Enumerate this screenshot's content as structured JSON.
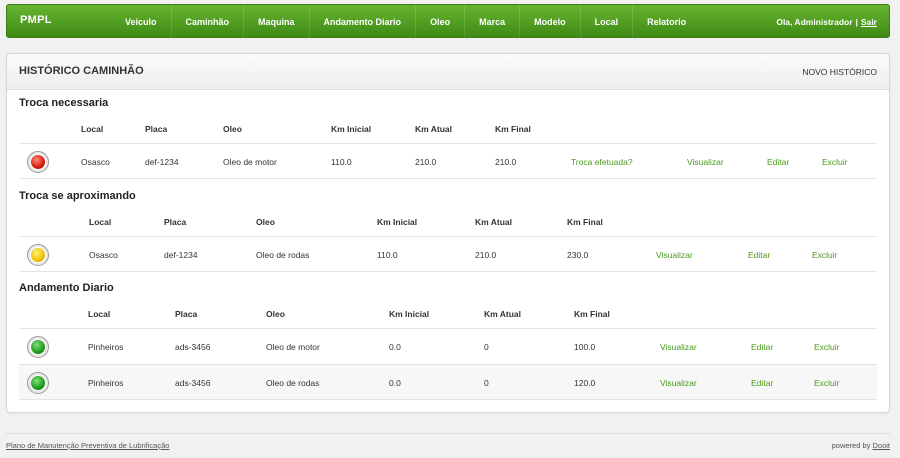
{
  "nav": {
    "brand": "PMPL",
    "items": [
      "Veiculo",
      "Caminhão",
      "Maquina",
      "Andamento Diario",
      "Oleo",
      "Marca",
      "Modelo",
      "Local",
      "Relatorio"
    ],
    "greeting": "Ola, Administrador",
    "separator": "|",
    "logout": "Sair"
  },
  "panel": {
    "title": "HISTÓRICO CAMINHÃO",
    "action": "NOVO HISTÓRICO"
  },
  "sections": [
    {
      "title": "Troca necessaria",
      "headers": [
        "Local",
        "Placa",
        "Oleo",
        "Km Inicial",
        "Km Atual",
        "Km Final"
      ],
      "rows": [
        {
          "status": "red",
          "local": "Osasco",
          "placa": "def-1234",
          "oleo": "Oleo de motor",
          "km_inicial": "110.0",
          "km_atual": "210.0",
          "km_final": "210.0",
          "troca": "Troca efetuada?",
          "visualizar": "Visualizar",
          "editar": "Editar",
          "excluir": "Excluir"
        }
      ]
    },
    {
      "title": "Troca se aproximando",
      "headers": [
        "Local",
        "Placa",
        "Oleo",
        "Km Inicial",
        "Km Atual",
        "Km Final"
      ],
      "rows": [
        {
          "status": "yellow",
          "local": "Osasco",
          "placa": "def-1234",
          "oleo": "Oleo de rodas",
          "km_inicial": "110.0",
          "km_atual": "210.0",
          "km_final": "230.0",
          "visualizar": "Visualizar",
          "editar": "Editar",
          "excluir": "Excluir"
        }
      ]
    },
    {
      "title": "Andamento Diario",
      "headers": [
        "Local",
        "Placa",
        "Oleo",
        "Km Inicial",
        "Km Atual",
        "Km Final"
      ],
      "rows": [
        {
          "status": "green",
          "local": "Pinheiros",
          "placa": "ads-3456",
          "oleo": "Oleo de motor",
          "km_inicial": "0.0",
          "km_atual": "0",
          "km_final": "100.0",
          "visualizar": "Visualizar",
          "editar": "Editar",
          "excluir": "Excluir"
        },
        {
          "status": "green",
          "local": "Pinheiros",
          "placa": "ads-3456",
          "oleo": "Oleo de rodas",
          "km_inicial": "0.0",
          "km_atual": "0",
          "km_final": "120.0",
          "visualizar": "Visualizar",
          "editar": "Editar",
          "excluir": "Excluir"
        }
      ]
    }
  ],
  "footer": {
    "left": "Plano de Manutenção Preventiva de Lubrificação",
    "right_prefix": "powered by",
    "right_link": "Dooit"
  }
}
